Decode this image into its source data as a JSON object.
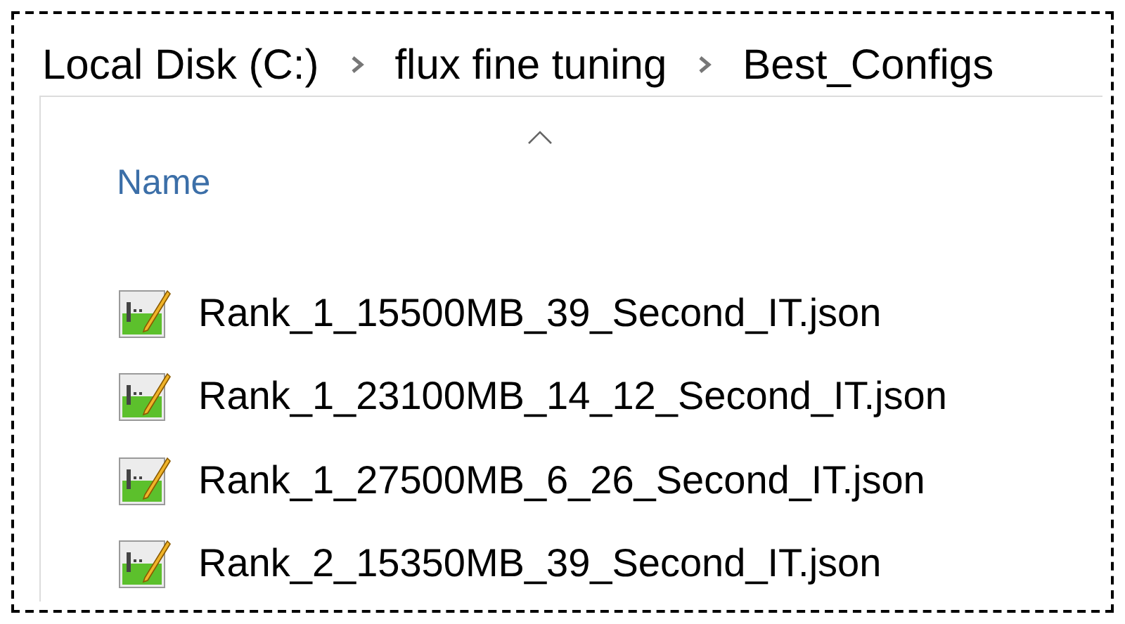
{
  "breadcrumb": [
    "Local Disk (C:)",
    "flux fine tuning",
    "Best_Configs"
  ],
  "column_header": {
    "label": "Name",
    "sort_ascending": true
  },
  "files": [
    {
      "name": "Rank_1_15500MB_39_Second_IT.json"
    },
    {
      "name": "Rank_1_23100MB_14_12_Second_IT.json"
    },
    {
      "name": "Rank_1_27500MB_6_26_Second_IT.json"
    },
    {
      "name": "Rank_2_15350MB_39_Second_IT.json"
    }
  ]
}
